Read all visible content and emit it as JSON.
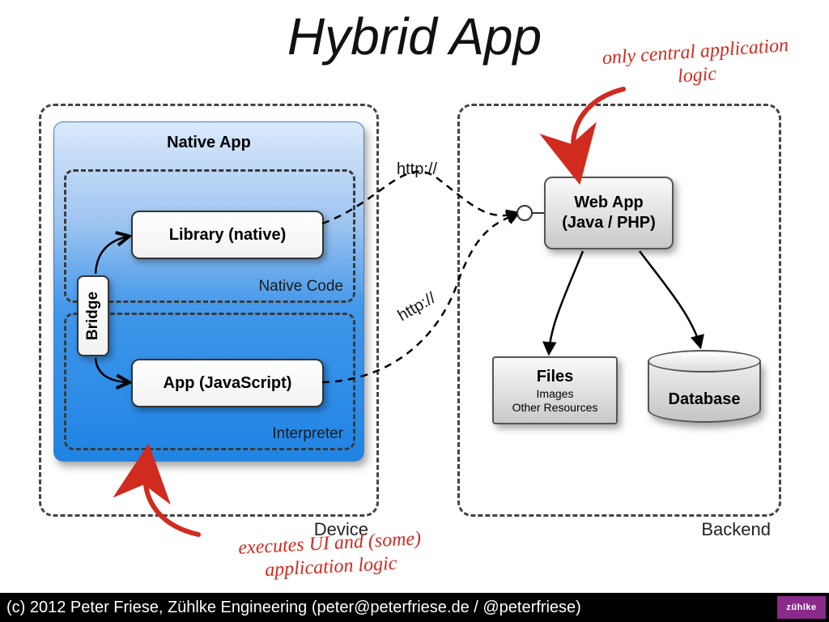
{
  "title": "Hybrid App",
  "device": {
    "label": "Device",
    "native_app": {
      "title": "Native App",
      "native_code_label": "Native Code",
      "interpreter_label": "Interpreter",
      "library_label": "Library (native)",
      "app_js_label": "App (JavaScript)",
      "bridge_label": "Bridge"
    }
  },
  "backend": {
    "label": "Backend",
    "webapp_label_line1": "Web App",
    "webapp_label_line2": "(Java / PHP)",
    "files": {
      "title": "Files",
      "sub1": "Images",
      "sub2": "Other Resources"
    },
    "database_label": "Database"
  },
  "connections": {
    "http1": "http://",
    "http2": "http://"
  },
  "annotations": {
    "top": "only central application logic",
    "bottom": "executes UI and (some) application logic"
  },
  "footer": "(c) 2012 Peter Friese, Zühlke Engineering (peter@peterfriese.de / @peterfriese)",
  "logo_text": "zühlke"
}
